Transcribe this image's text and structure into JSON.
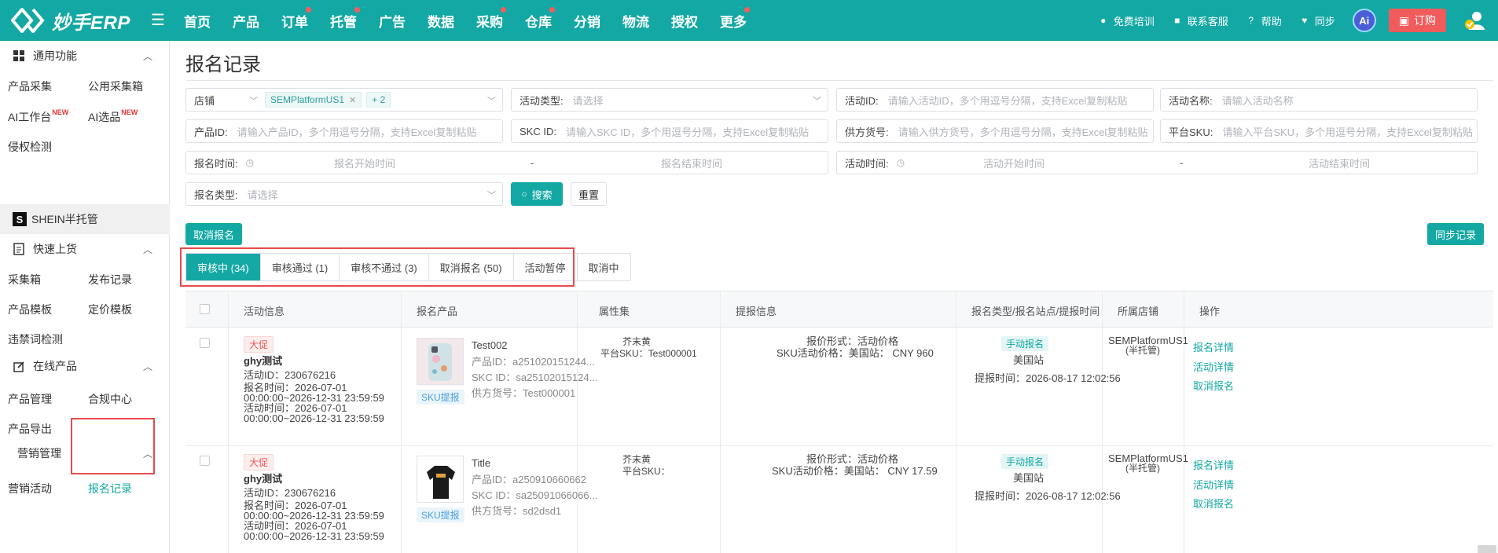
{
  "app": {
    "logo_text": "妙手ERP"
  },
  "nav": [
    {
      "label": "首页",
      "dot": false
    },
    {
      "label": "产品",
      "dot": false
    },
    {
      "label": "订单",
      "dot": true
    },
    {
      "label": "托管",
      "dot": true
    },
    {
      "label": "广告",
      "dot": false
    },
    {
      "label": "数据",
      "dot": false
    },
    {
      "label": "采购",
      "dot": true
    },
    {
      "label": "仓库",
      "dot": true
    },
    {
      "label": "分销",
      "dot": false
    },
    {
      "label": "物流",
      "dot": false
    },
    {
      "label": "授权",
      "dot": false
    },
    {
      "label": "更多",
      "dot": true
    }
  ],
  "top_right": {
    "training": "免费培训",
    "service": "联系客服",
    "help": "帮助",
    "sync": "同步",
    "ai": "Ai",
    "order": "订购"
  },
  "sidebar": {
    "common": "通用功能",
    "product_collect": "产品采集",
    "public_box": "公用采集箱",
    "ai_workbench": "AI工作台",
    "ai_select": "AI选品",
    "new_badge": "NEW",
    "infringe": "侵权检测",
    "shein": "SHEIN半托管",
    "quick_upload": "快速上货",
    "collect_box": "采集箱",
    "publish_log": "发布记录",
    "product_tpl": "产品模板",
    "price_tpl": "定价模板",
    "banned_words": "违禁词检测",
    "online_products": "在线产品",
    "product_mgmt": "产品管理",
    "compliance": "合规中心",
    "product_export": "产品导出",
    "marketing": "营销管理",
    "marketing_activity": "营销活动",
    "signup_records": "报名记录"
  },
  "page": {
    "title": "报名记录"
  },
  "filters": {
    "store_label": "店铺",
    "store_tag": "SEMPlatformUS1",
    "store_more": "+ 2",
    "activity_type_label": "活动类型:",
    "activity_type_ph": "请选择",
    "activity_id_label": "活动ID:",
    "activity_id_ph": "请输入活动ID，多个用逗号分隔，支持Excel复制粘贴",
    "activity_name_label": "活动名称:",
    "activity_name_ph": "请输入活动名称",
    "product_id_label": "产品ID:",
    "product_id_ph": "请输入产品ID，多个用逗号分隔，支持Excel复制粘贴",
    "skc_label": "SKC ID:",
    "skc_ph": "请输入SKC ID，多个用逗号分隔，支持Excel复制粘贴",
    "supplier_label": "供方货号:",
    "supplier_ph": "请输入供方货号，多个用逗号分隔，支持Excel复制粘贴",
    "platform_sku_label": "平台SKU:",
    "platform_sku_ph": "请输入平台SKU，多个用逗号分隔，支持Excel复制粘贴",
    "signup_time_label": "报名时间:",
    "signup_start_ph": "报名开始时间",
    "signup_end_ph": "报名结束时间",
    "activity_time_label": "活动时间:",
    "activity_start_ph": "活动开始时间",
    "activity_end_ph": "活动结束时间",
    "dash": "-",
    "signup_type_label": "报名类型:",
    "signup_type_ph": "请选择",
    "search_btn": "搜索",
    "reset_btn": "重置"
  },
  "actions": {
    "cancel_signup": "取消报名",
    "sync_records": "同步记录"
  },
  "tabs": [
    {
      "label": "审核中 (34)",
      "active": true
    },
    {
      "label": "审核通过 (1)",
      "active": false
    },
    {
      "label": "审核不通过 (3)",
      "active": false
    },
    {
      "label": "取消报名 (50)",
      "active": false
    },
    {
      "label": "活动暂停",
      "active": false
    },
    {
      "label": "取消中",
      "active": false
    }
  ],
  "table": {
    "headers": [
      "活动信息",
      "报名产品",
      "属性集",
      "提报信息",
      "报名类型/报名站点/提报时间",
      "所属店铺",
      "操作"
    ],
    "rows": [
      {
        "promo": "大促",
        "name": "ghy测试",
        "activity_id": "活动ID：230676216",
        "signup_time_a": "报名时间：2026-07-01",
        "signup_time_b": "00:00:00~2026-12-31 23:59:59",
        "act_time_a": "活动时间：2026-07-01",
        "act_time_b": "00:00:00~2026-12-31 23:59:59",
        "product_title": "Test002",
        "product_id": "产品ID：a251020151244...",
        "skc_id": "SKC ID：sa25102015124...",
        "supplier_no": "供方货号：Test000001",
        "sku_tag": "SKU提报",
        "attr": "芥末黄",
        "platform_sku": "平台SKU：Test000001",
        "report_form": "报价形式：活动价格",
        "sku_price": "SKU活动价格：美国站：  CNY 960",
        "signup_type": "手动报名",
        "site": "美国站",
        "report_time": "提报时间：2026-08-17 12:02:56",
        "store": "SEMPlatformUS1",
        "store_sub": "(半托管)",
        "op1": "报名详情",
        "op2": "活动详情",
        "op3": "取消报名"
      },
      {
        "promo": "大促",
        "name": "ghy测试",
        "activity_id": "活动ID：230676216",
        "signup_time_a": "报名时间：2026-07-01",
        "signup_time_b": "00:00:00~2026-12-31 23:59:59",
        "act_time_a": "活动时间：2026-07-01",
        "act_time_b": "00:00:00~2026-12-31 23:59:59",
        "product_title": "Title",
        "product_id": "产品ID：a250910660662",
        "skc_id": "SKC ID：sa25091066066...",
        "supplier_no": "供方货号：sd2dsd1",
        "sku_tag": "SKU提报",
        "attr": "芥末黄",
        "platform_sku": "平台SKU：",
        "report_form": "报价形式：活动价格",
        "sku_price": "SKU活动价格：美国站：  CNY 17.59",
        "signup_type": "手动报名",
        "site": "美国站",
        "report_time": "提报时间：2026-08-17 12:02:56",
        "store": "SEMPlatformUS1",
        "store_sub": "(半托管)",
        "op1": "报名详情",
        "op2": "活动详情",
        "op3": "取消报名"
      }
    ]
  }
}
